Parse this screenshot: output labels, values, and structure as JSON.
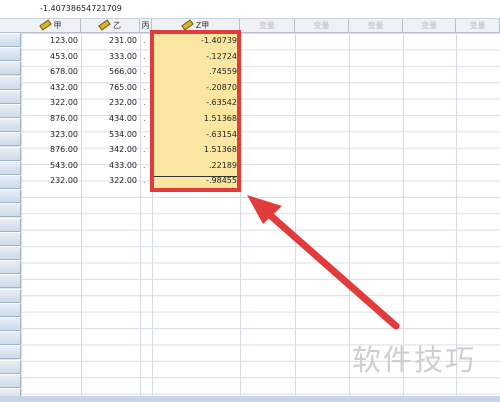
{
  "formula_bar": {
    "value": "-1.40738654721709"
  },
  "columns": [
    {
      "name": "甲",
      "icon": "ruler-icon",
      "placeholder": false
    },
    {
      "name": "乙",
      "icon": "ruler-icon",
      "placeholder": false
    },
    {
      "name": "丙",
      "icon": "",
      "placeholder": false
    },
    {
      "name": "Z甲",
      "icon": "ruler-icon",
      "placeholder": false
    },
    {
      "name": "变量",
      "icon": "",
      "placeholder": true
    },
    {
      "name": "变量",
      "icon": "",
      "placeholder": true
    },
    {
      "name": "变量",
      "icon": "",
      "placeholder": true
    },
    {
      "name": "变量",
      "icon": "",
      "placeholder": true
    },
    {
      "name": "变量",
      "icon": "",
      "placeholder": true
    }
  ],
  "rows": [
    {
      "jia": "123.00",
      "yi": "231.00",
      "bing": ".",
      "zjia": "-1.40739"
    },
    {
      "jia": "453.00",
      "yi": "333.00",
      "bing": ".",
      "zjia": "-.12724"
    },
    {
      "jia": "678.00",
      "yi": "566.00",
      "bing": ".",
      "zjia": ".74559"
    },
    {
      "jia": "432.00",
      "yi": "765.00",
      "bing": ".",
      "zjia": "-.20870"
    },
    {
      "jia": "322.00",
      "yi": "232.00",
      "bing": ".",
      "zjia": "-.63542"
    },
    {
      "jia": "876.00",
      "yi": "434.00",
      "bing": ".",
      "zjia": "1.51368"
    },
    {
      "jia": "323.00",
      "yi": "534.00",
      "bing": ".",
      "zjia": "-.63154"
    },
    {
      "jia": "876.00",
      "yi": "342.00",
      "bing": ".",
      "zjia": "1.51368"
    },
    {
      "jia": "543.00",
      "yi": "433.00",
      "bing": ".",
      "zjia": ".22189"
    },
    {
      "jia": "232.00",
      "yi": "322.00",
      "bing": ".",
      "zjia": "-.98455"
    }
  ],
  "watermark": "软件技巧",
  "colors": {
    "highlight": "#fbe7a1",
    "annotation": "#e23b3b"
  }
}
